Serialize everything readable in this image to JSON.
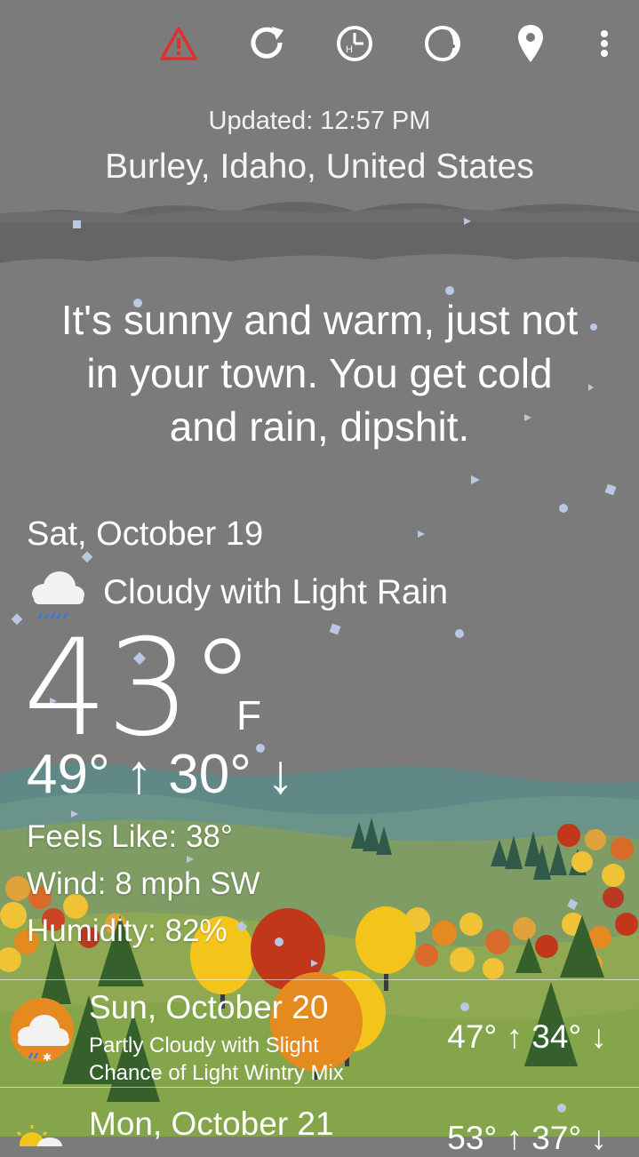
{
  "toolbar": {
    "icons": [
      "alert-icon",
      "refresh-icon",
      "history-icon",
      "moon-phase-icon",
      "location-pin-icon",
      "overflow-menu-icon"
    ],
    "alert_color": "#e0302d"
  },
  "header": {
    "updated": "Updated: 12:57 PM",
    "location": "Burley, Idaho, United States"
  },
  "snark": {
    "line1": "It's sunny and warm, just not",
    "line2": "in your town. You get cold",
    "line3": "and rain, dipshit."
  },
  "current": {
    "date": "Sat, October 19",
    "condition": "Cloudy with Light Rain",
    "condition_icon": "cloud-rain-icon",
    "temp": "43°",
    "unit": "F",
    "hilo": "49° ↑ 30° ↓",
    "feels_like": "Feels Like: 38°",
    "wind": "Wind: 8 mph SW",
    "humidity": "Humidity: 82%"
  },
  "forecast": [
    {
      "day": "Sun, October 20",
      "desc_line1": "Partly Cloudy with Slight",
      "desc_line2": "Chance of Light Wintry Mix",
      "hilo": "47° ↑ 34° ↓",
      "icon": "partly-cloudy-wintry-mix-icon"
    },
    {
      "day": "Mon, October 21",
      "hilo": "53° ↑ 37° ↓",
      "icon": "partly-sunny-icon"
    }
  ],
  "colors": {
    "sky": "#7b7b7b",
    "cloud_band": "#646464",
    "hill_teal": "#5e8a87",
    "grass": "#8fa952",
    "grass_dark": "#6f9340",
    "tree_orange": "#e58a1f",
    "tree_red": "#c2361a",
    "tree_yellow": "#f3c51b"
  }
}
